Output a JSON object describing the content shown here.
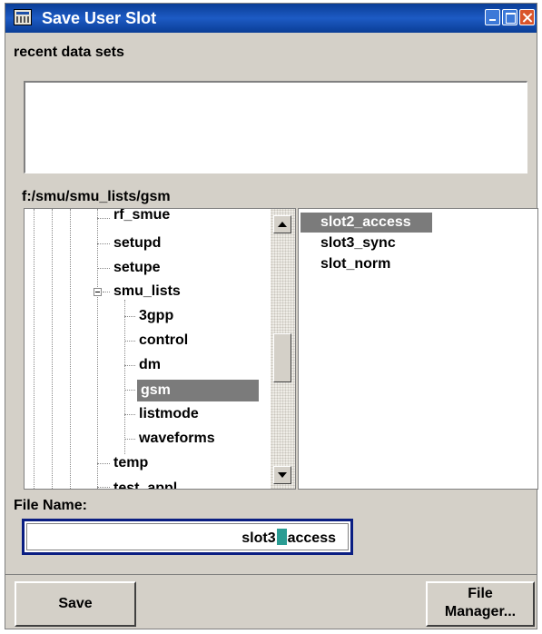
{
  "window": {
    "title": "Save User Slot"
  },
  "titlebar": {
    "icons": [
      "app-icon",
      "minimize-icon",
      "maximize-icon",
      "close-icon"
    ]
  },
  "recent": {
    "label": "recent data sets",
    "items": []
  },
  "path": "f:/smu/smu_lists/gsm",
  "tree": {
    "items": [
      {
        "label": "rf_smue"
      },
      {
        "label": "setupd"
      },
      {
        "label": "setupe"
      },
      {
        "label": "smu_lists",
        "expanded": true
      },
      {
        "label": "3gpp"
      },
      {
        "label": "control"
      },
      {
        "label": "dm"
      },
      {
        "label": "gsm",
        "selected": true
      },
      {
        "label": "listmode"
      },
      {
        "label": "waveforms"
      },
      {
        "label": "temp"
      },
      {
        "label": "test_appl"
      }
    ]
  },
  "files": {
    "items": [
      {
        "label": "slot2_access",
        "selected": true
      },
      {
        "label": "slot3_sync"
      },
      {
        "label": "slot_norm"
      }
    ]
  },
  "filename": {
    "label": "File Name:",
    "value_before_cursor": "slot3",
    "value_after_cursor": "access"
  },
  "buttons": {
    "save": "Save",
    "file_manager_line1": "File",
    "file_manager_line2": "Manager..."
  },
  "colors": {
    "titlebar": "#0a3d96",
    "selection": "#7b7b7b",
    "focus_border": "#0a1e82",
    "cursor": "#2a9c93",
    "panel": "#d4d0c8"
  }
}
